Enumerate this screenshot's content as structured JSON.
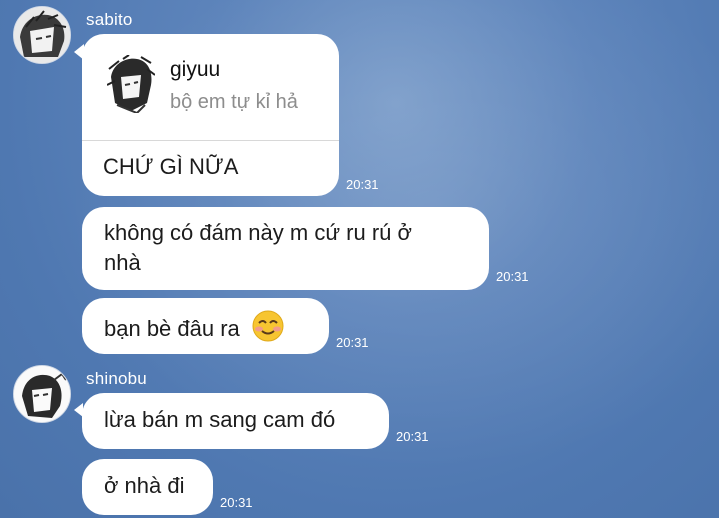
{
  "messages": [
    {
      "sender": "sabito",
      "reply": {
        "name": "giyuu",
        "preview": "bộ em tự kỉ hả"
      },
      "text": "CHỨ GÌ NỮA",
      "time": "20:31"
    },
    {
      "text_line1": "không có đám này m cứ ru rú ở",
      "text_line2": "nhà",
      "time": "20:31"
    },
    {
      "text": "bạn bè đâu ra",
      "emoji": "smiling-face-icon",
      "time": "20:31"
    },
    {
      "sender": "shinobu",
      "text": "lừa bán m sang cam đó",
      "time": "20:31"
    },
    {
      "text": "ở nhà đi",
      "time": "20:31"
    }
  ]
}
